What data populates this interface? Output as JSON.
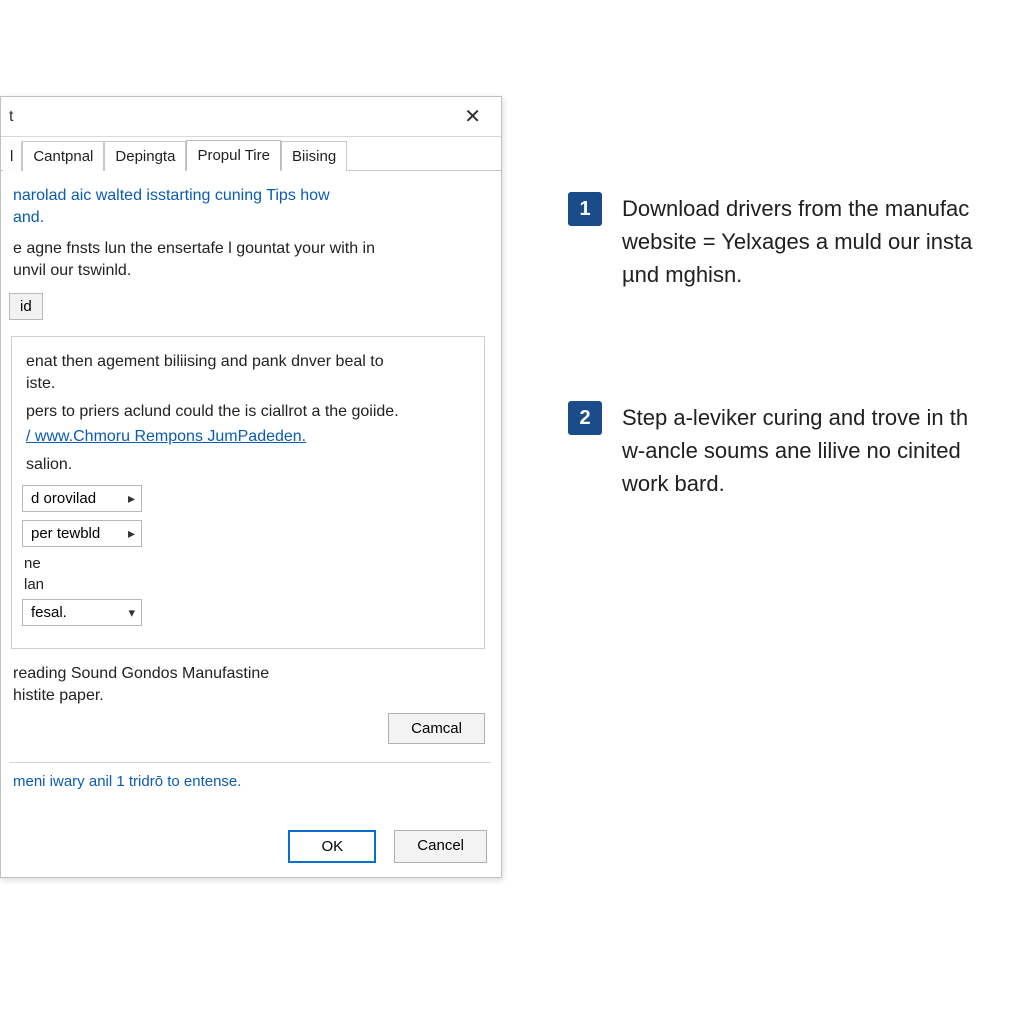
{
  "dialog": {
    "title_fragment": "t",
    "close_glyph": "✕",
    "tabs": {
      "frag_left": "l",
      "cantpnal": "Cantpnal",
      "depingta": "Depingta",
      "propul_tire": "Propul Tire",
      "bising": "Biising"
    },
    "intro_blue": "narolad aic walted isstarting cuning Tips how\nand.",
    "intro_body": "e agne fnsts lun the ensertafe l gountat your with in\nunvil our tswinld.",
    "btn_id": "id",
    "group": {
      "para1": "enat then agement biliising and pank dnver beal to\niste.",
      "para2_pre": "pers to priers aclund could the is ciallrot a the goiide.",
      "link": "/ www.Chmoru Rempons JumPadeden.",
      "para3": "salion.",
      "menu1": "d orovilad",
      "menu2": "per tewbld",
      "label1": "ne",
      "label2": "lan",
      "combo": "fesal."
    },
    "footer1": "reading Sound Gondos Manufastine\nhistite paper.",
    "btn_camcal": "Camcal",
    "blue_note": "meni iwary anil 1 tridrō to entense.",
    "btn_ok": "OK",
    "btn_cancel": "Cancel"
  },
  "steps": [
    {
      "num": "1",
      "text": "Download drivers from the manufac\nwebsite = Yelxages a muld our insta\nµnd mghisn."
    },
    {
      "num": "2",
      "text": "Step a-leviker curing and trove in th\nw-ancle soums ane lilive no cinited\nwork bard."
    }
  ]
}
